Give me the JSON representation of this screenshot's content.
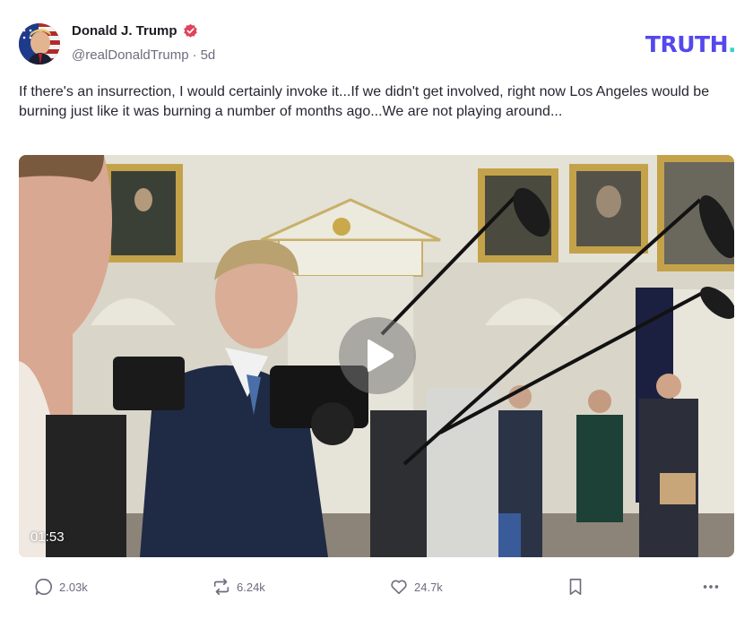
{
  "post": {
    "author": {
      "display_name": "Donald J. Trump",
      "handle": "@realDonaldTrump",
      "separator": "·",
      "age": "5d",
      "verified": true
    },
    "brand": {
      "logo_text": "TRUTH",
      "logo_dot": ".",
      "primary_color": "#5448ee",
      "accent_color": "#31d6c4"
    },
    "text": "If there's an insurrection, I would certainly invoke it...If we didn't get involved, right now Los Angeles would be burning just like it was burning a number of months ago...We are not playing around...",
    "video": {
      "duration": "01:53",
      "play_icon": "play-icon"
    },
    "actions": {
      "replies": "2.03k",
      "retruths": "6.24k",
      "likes": "24.7k",
      "bookmark_icon": "bookmark-icon",
      "more_icon": "more-icon"
    }
  }
}
